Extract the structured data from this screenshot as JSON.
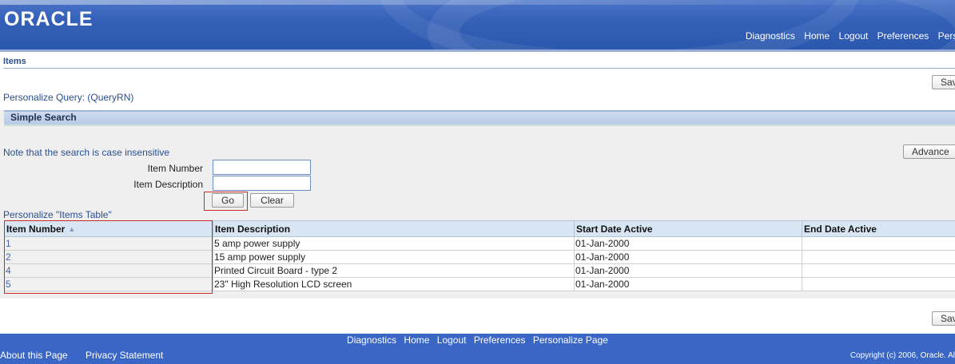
{
  "brand": {
    "logo_text": "ORACLE"
  },
  "global_nav": [
    "Diagnostics",
    "Home",
    "Logout",
    "Preferences",
    "Perso"
  ],
  "page": {
    "title": "Items",
    "save_label": "Sav"
  },
  "personalize_query_label": "Personalize Query: (QueryRN)",
  "simple_search": {
    "header": "Simple Search",
    "note": "Note that the search is case insensitive",
    "advanced_label": "Advance",
    "fields": {
      "item_number": {
        "label": "Item Number",
        "value": ""
      },
      "item_description": {
        "label": "Item Description",
        "value": ""
      }
    },
    "go_label": "Go",
    "clear_label": "Clear"
  },
  "personalize_table_label": "Personalize \"Items Table\"",
  "table": {
    "columns": [
      "Item Number",
      "Item Description",
      "Start Date Active",
      "End Date Active"
    ],
    "rows": [
      [
        "1",
        "5 amp power supply",
        "01-Jan-2000",
        ""
      ],
      [
        "2",
        "15 amp power supply",
        "01-Jan-2000",
        ""
      ],
      [
        "4",
        "Printed Circuit Board - type 2",
        "01-Jan-2000",
        ""
      ],
      [
        "5",
        "23\" High Resolution LCD screen",
        "01-Jan-2000",
        ""
      ]
    ]
  },
  "footer": {
    "nav": [
      "Diagnostics",
      "Home",
      "Logout",
      "Preferences",
      "Personalize Page"
    ],
    "about": "About this Page",
    "privacy": "Privacy Statement",
    "copyright": "Copyright (c) 2006, Oracle. Al"
  },
  "colors": {
    "header_blue": "#2a57ad",
    "footer_blue": "#3a66c5",
    "link": "#2a4f8d",
    "highlight_red": "#cc2a2a"
  }
}
